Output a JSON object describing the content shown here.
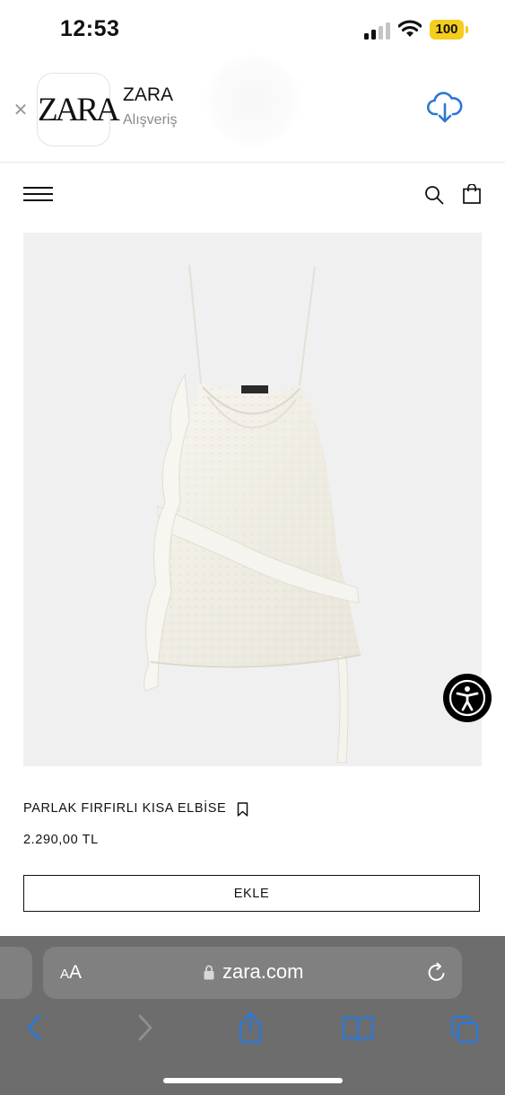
{
  "status_bar": {
    "time": "12:53",
    "battery": "100"
  },
  "banner": {
    "app_logo_text": "ZARA",
    "app_name": "ZARA",
    "app_category": "Alışveriş",
    "icons": [
      "close-icon",
      "download-cloud-icon"
    ]
  },
  "header": {
    "icons": [
      "menu-icon",
      "search-icon",
      "shopping-bag-icon"
    ]
  },
  "product": {
    "name": "PARLAK FIRFIRLI KISA ELBİSE",
    "price": "2.290,00 TL",
    "add_label": "EKLE",
    "image_background": "#f1f0f1"
  },
  "browser": {
    "text_size_label_small": "A",
    "text_size_label_large": "A",
    "url": "zara.com",
    "accent": "#2c78d6",
    "icons": [
      "lock-icon",
      "reload-icon",
      "back-icon",
      "forward-icon",
      "share-icon",
      "bookmarks-icon",
      "tabs-icon"
    ]
  }
}
